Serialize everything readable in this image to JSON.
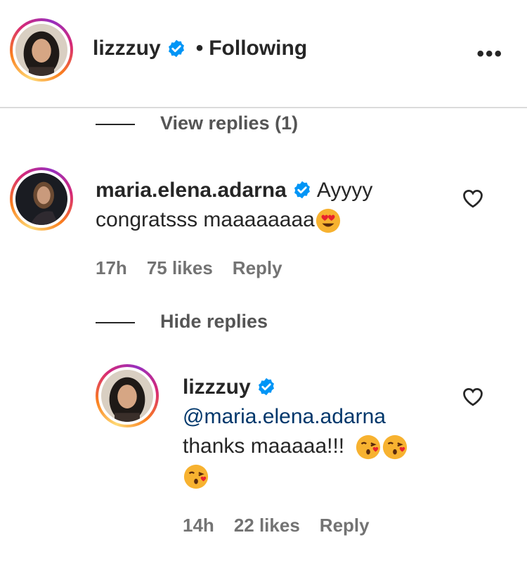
{
  "header": {
    "username": "lizzzuy",
    "separator": "•",
    "follow_status": "Following",
    "more_label": "•••"
  },
  "thread": {
    "view_replies_label": "View replies (1)",
    "hide_replies_label": "Hide replies"
  },
  "comments": [
    {
      "username": "maria.elena.adarna",
      "text_line1": "Ayyyy",
      "text_line2": "congratsss maaaaaaaa",
      "emoji": "heart-eyes",
      "time": "17h",
      "likes": "75 likes",
      "reply_label": "Reply"
    },
    {
      "username": "lizzzuy",
      "mention": "@maria.elena.adarna",
      "text": "thanks maaaaa!!!",
      "emoji": "kissing-face",
      "time": "14h",
      "likes": "22 likes",
      "reply_label": "Reply"
    }
  ],
  "colors": {
    "verified": "#0095f6",
    "mention": "#00376b",
    "muted": "#737373"
  }
}
